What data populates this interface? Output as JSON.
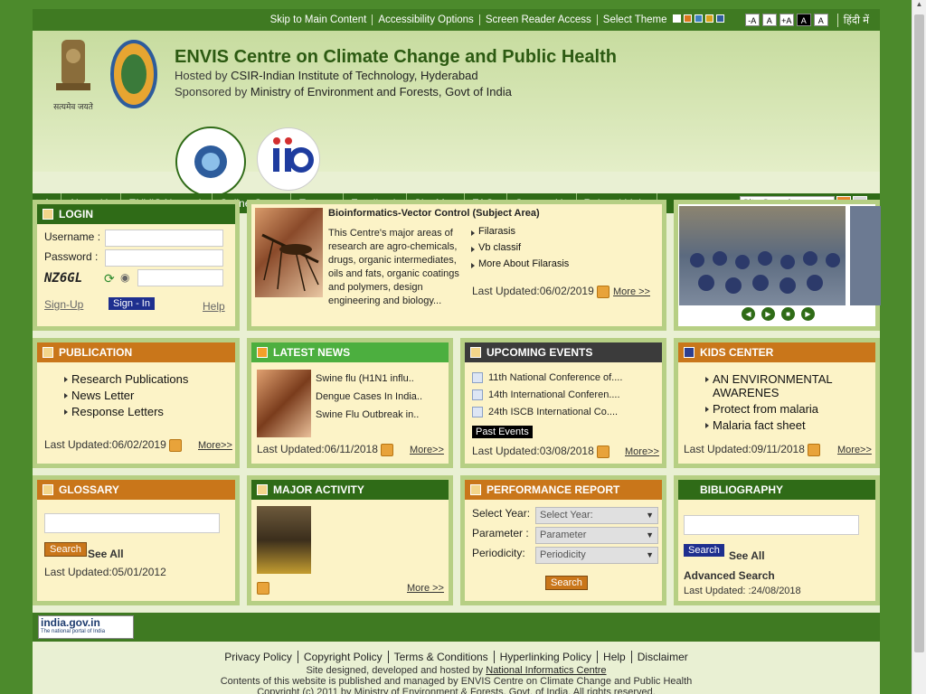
{
  "topbar": {
    "skip": "Skip to Main Content",
    "access": "Accessibility Options",
    "reader": "Screen Reader Access",
    "theme": "Select Theme",
    "theme_colors": [
      "#ffffff",
      "#d9751b",
      "#3d7fc1",
      "#d9a21b",
      "#2f5d9d"
    ],
    "fontsizes": [
      "-A",
      "A",
      "+A",
      "A",
      "A"
    ],
    "hindi": "हिंदी में"
  },
  "header": {
    "title": "ENVIS Centre on Climate Change and Public Health",
    "hosted_label": "Hosted by",
    "hosted_link": "CSIR-Indian Institute of Technology, Hyderabad",
    "sponsored_label": "Sponsored by",
    "sponsored_link": "Ministry of Environment and Forests, Govt of India",
    "emblem_text": "सत्यमेव जयते"
  },
  "nav": {
    "items": [
      "About Us",
      "ENVIS Network",
      "Online Query",
      "Experts",
      "Feedback",
      "Site Map",
      "FAQs",
      "Contact Us",
      "Related Links"
    ],
    "search_placeholder": "Site Search"
  },
  "login": {
    "title": "LOGIN",
    "username": "Username :",
    "password": "Password :",
    "captcha": "NZ6GL",
    "signup": "Sign-Up",
    "signin": "Sign - In",
    "help": "Help"
  },
  "feature": {
    "title": "Bioinformatics-Vector Control (Subject Area)",
    "desc": "This Centre's major areas of research are agro-chemicals, drugs, organic intermediates, oils and fats, organic coatings and polymers, design engineering and biology...",
    "links": [
      "Filarasis",
      "Vb classif",
      "More About Filarasis"
    ],
    "updated": "Last Updated:06/02/2019",
    "more": "More >>"
  },
  "publication": {
    "title": "PUBLICATION",
    "items": [
      "Research Publications",
      "News Letter",
      "Response Letters"
    ],
    "updated": "Last Updated:06/02/2019",
    "more": "More>>"
  },
  "news": {
    "title": "LATEST NEWS",
    "items": [
      "Swine flu (H1N1 influ..",
      "Dengue Cases In India..",
      "Swine Flu Outbreak in.."
    ],
    "updated": "Last Updated:06/11/2018",
    "more": "More>>"
  },
  "events": {
    "title": "UPCOMING EVENTS",
    "items": [
      "11th National Conference of....",
      "14th International Conferen....",
      "24th ISCB International Co...."
    ],
    "past": "Past Events",
    "updated": "Last Updated:03/08/2018",
    "more": "More>>"
  },
  "kids": {
    "title": "KIDS CENTER",
    "items": [
      "AN ENVIRONMENTAL AWARENES",
      "Protect from malaria",
      "Malaria fact sheet"
    ],
    "updated": "Last Updated:09/11/2018",
    "more": "More>>"
  },
  "glossary": {
    "title": "GLOSSARY",
    "search": "Search",
    "seeall": "See All",
    "updated": "Last Updated:05/01/2012"
  },
  "activity": {
    "title": "MAJOR ACTIVITY",
    "more": "More >>"
  },
  "performance": {
    "title": "PERFORMANCE REPORT",
    "year_label": "Select Year:",
    "year_value": "Select Year:",
    "param_label": "Parameter :",
    "param_value": "Parameter",
    "period_label": "Periodicity:",
    "period_value": "Periodicity",
    "search": "Search"
  },
  "bibliography": {
    "title": "BIBLIOGRAPHY",
    "search": "Search",
    "seeall": "See All",
    "advanced": "Advanced Search",
    "updated": "Last Updated: :24/08/2018"
  },
  "footer": {
    "indiagov": "india.gov.in",
    "indiagov_sub": "The national portal of India",
    "links": [
      "Privacy Policy",
      "Copyright Policy",
      "Terms & Conditions",
      "Hyperlinking Policy",
      "Help",
      "Disclaimer"
    ],
    "designed": "Site designed, developed and hosted by",
    "nic": "National Informatics Centre",
    "contents": "Contents of this website is published and managed by ENVIS Centre on Climate Change and Public Health",
    "copyright": "Copyright (c) 2011 by Ministry of Environment & Forests, Govt. of India. All rights reserved."
  }
}
